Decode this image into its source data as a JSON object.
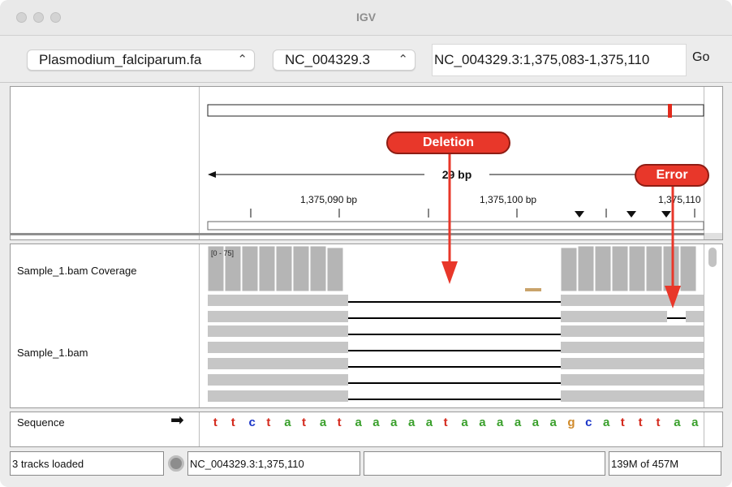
{
  "window": {
    "title": "IGV"
  },
  "toolbar": {
    "genome": "Plasmodium_falciparum.fa",
    "chromosome": "NC_004329.3",
    "locus": "NC_004329.3:1,375,083-1,375,110",
    "go_label": "Go",
    "dropdown_icon": "chevron-updown-icon"
  },
  "ruler": {
    "span_label": "29 bp",
    "ticks": [
      "1,375,090 bp",
      "1,375,100 bp",
      "1,375,110 bp"
    ]
  },
  "tracks": {
    "coverage_label": "Sample_1.bam Coverage",
    "coverage_range": "[0 - 75]",
    "alignment_label": "Sample_1.bam",
    "sequence_label": "Sequence",
    "sequence_bases": [
      "t",
      "t",
      "c",
      "t",
      "a",
      "t",
      "a",
      "t",
      "a",
      "a",
      "a",
      "a",
      "a",
      "t",
      "a",
      "a",
      "a",
      "a",
      "a",
      "a",
      "g",
      "c",
      "a",
      "t",
      "t",
      "t",
      "a",
      "a"
    ]
  },
  "annotations": {
    "deletion": "Deletion",
    "error": "Error"
  },
  "statusbar": {
    "tracks_loaded": "3 tracks loaded",
    "position": "NC_004329.3:1,375,110",
    "middle": "",
    "memory": "139M of 457M"
  },
  "colors": {
    "base_a": "#3aa02c",
    "base_t": "#d42a1d",
    "base_c": "#1a35c8",
    "base_g": "#d08a2a",
    "callout": "#e8372a",
    "coverage_bar": "#b5b5b5",
    "read": "#c6c6c6"
  }
}
